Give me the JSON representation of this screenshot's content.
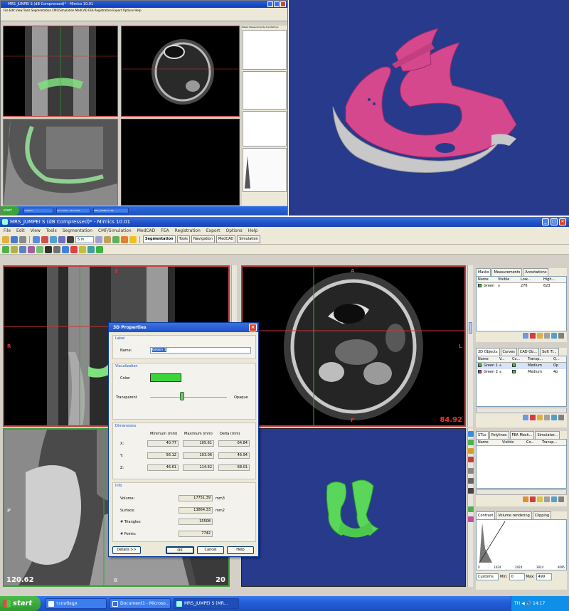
{
  "top_shot": {
    "title": "MRS_JUNPEI S (dB Compressed)* - Mimics 10.01",
    "menu": "File  Edit  View  Tools  Segmentation  CMF/Simulation  MedCAD  FEA  Registration  Export  Options  Help",
    "side_tabs": [
      "Masks",
      "Measurements",
      "Annotations"
    ],
    "taskbar_start": "start",
    "taskbar_items": [
      "untitled",
      "Document - Microsoft",
      "MRS_JUMPEI S (dB..."
    ]
  },
  "window": {
    "title": "MRS_JUMPEI S (dB Compressed)* - Mimics 10.01",
    "controls": {
      "minimize": "_",
      "maximize": "□",
      "close": "✕"
    }
  },
  "menubar": [
    "File",
    "Edit",
    "View",
    "Tools",
    "Segmentation",
    "CMF/Simulation",
    "MedCAD",
    "FEA",
    "Registration",
    "Export",
    "Options",
    "Help"
  ],
  "toolbar": {
    "view_select": "5 in",
    "tabs": [
      "Segmentation",
      "Tools",
      "Navigation",
      "MedCAD",
      "Simulation"
    ],
    "active_tab": "Segmentation"
  },
  "views": {
    "sagittal": {
      "top": "T",
      "left": "R"
    },
    "axial": {
      "top": "A",
      "right": "L",
      "bottom": "P",
      "zoom": "84.92"
    },
    "coronal": {
      "left": "P",
      "bottom": "B",
      "zoom_left": "120.62",
      "zoom_right": "20"
    }
  },
  "masks_panel": {
    "tabs": [
      "Masks",
      "Measurements",
      "Annotations"
    ],
    "columns": [
      "Name",
      "Visible",
      "Low...",
      "High..."
    ],
    "rows": [
      {
        "name": "Green",
        "visible": "๏",
        "low": "276",
        "high": "623",
        "color": "#3cc83c"
      }
    ]
  },
  "objects_panel": {
    "tabs": [
      "3D Objects",
      "Curves",
      "CAD Ob...",
      "Soft Ti..."
    ],
    "columns": [
      "Name",
      "V...",
      "Co...",
      "Transp...",
      "Q..."
    ],
    "rows": [
      {
        "name": "Green 1",
        "visible": "๏",
        "transp": "Medium",
        "quality": "Op",
        "color": "#3cc83c"
      },
      {
        "name": "Green 2",
        "visible": "๏",
        "transp": "Medium",
        "quality": "4p",
        "color": "#c83c8c"
      }
    ]
  },
  "stl_panel": {
    "tabs": [
      "STLs",
      "Polylines",
      "FEA Mesh...",
      "Simulator..."
    ],
    "columns": [
      "Name",
      "Visible",
      "Co...",
      "Transp..."
    ]
  },
  "contrast_panel": {
    "tabs": [
      "Contrast",
      "Volume rendering",
      "Clipping"
    ],
    "axis": [
      "0",
      "1024",
      "2024",
      "3024",
      "4095"
    ],
    "preset": "Customs",
    "min_label": "Min:",
    "min_value": "0",
    "max_label": "Max:",
    "max_value": "499"
  },
  "dialog": {
    "title": "3D Properties",
    "label_group": "Label",
    "name_label": "Name:",
    "name_value": "Green 1",
    "visual_group": "Visualization",
    "color_label": "Color:",
    "color_value": "#3cd43c",
    "transparent_label": "Transparent",
    "opaque_label": "Opaque",
    "transparency_level": 0.42,
    "dims_group": "Dimensions",
    "dims_headers": [
      "Minimum (mm)",
      "Maximum (mm)",
      "Delta (mm)"
    ],
    "dims_rows": [
      {
        "axis": "X:",
        "min": "40.77",
        "max": "105.61",
        "delta": "64.84"
      },
      {
        "axis": "Y:",
        "min": "56.12",
        "max": "103.06",
        "delta": "46.94"
      },
      {
        "axis": "Z:",
        "min": "46.61",
        "max": "114.62",
        "delta": "68.01"
      }
    ],
    "info_group": "Info",
    "volume_label": "Volume:",
    "volume_value": "17751.39",
    "volume_unit": "mm3",
    "surface_label": "Surface:",
    "surface_value": "13864.33",
    "surface_unit": "mm2",
    "triangles_label": "# Triangles:",
    "triangles_value": "15508",
    "points_label": "# Points:",
    "points_value": "7742",
    "details_button": "Details >>",
    "ok_button": "OK",
    "cancel_button": "Cancel",
    "help_button": "Help"
  },
  "taskbar": {
    "start": "start",
    "items": [
      "ระบบข้อมูล",
      "Document1 - Microso...",
      "MRS_JUMPEI S (MR..."
    ],
    "tray": "TH  ◀ 🔊 14:17"
  }
}
